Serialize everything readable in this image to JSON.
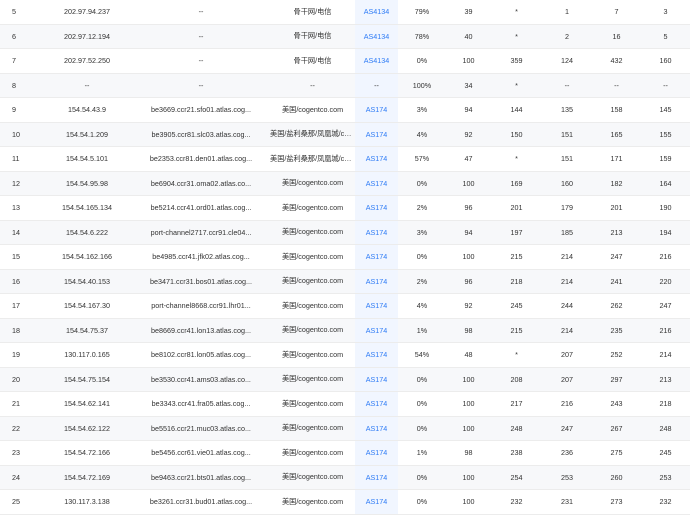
{
  "accent": "#2f7cf6",
  "rows": [
    {
      "hop": "5",
      "ip": "202.97.94.237",
      "host": "--",
      "loc": "骨干网/电信",
      "as": "AS4134",
      "loss": "79%",
      "sent": "39",
      "last": "*",
      "best": "1",
      "avg": "7",
      "worst": "3"
    },
    {
      "hop": "6",
      "ip": "202.97.12.194",
      "host": "--",
      "loc": "骨干网/电信",
      "as": "AS4134",
      "loss": "78%",
      "sent": "40",
      "last": "*",
      "best": "2",
      "avg": "16",
      "worst": "5"
    },
    {
      "hop": "7",
      "ip": "202.97.52.250",
      "host": "--",
      "loc": "骨干网/电信",
      "as": "AS4134",
      "loss": "0%",
      "sent": "100",
      "last": "359",
      "best": "124",
      "avg": "432",
      "worst": "160"
    },
    {
      "hop": "8",
      "ip": "--",
      "host": "--",
      "loc": "--",
      "as": "--",
      "loss": "100%",
      "sent": "34",
      "last": "*",
      "best": "--",
      "avg": "--",
      "worst": "--"
    },
    {
      "hop": "9",
      "ip": "154.54.43.9",
      "host": "be3669.ccr21.sfo01.atlas.cog...",
      "loc": "美国/cogentco.com",
      "as": "AS174",
      "loss": "3%",
      "sent": "94",
      "last": "144",
      "best": "135",
      "avg": "158",
      "worst": "145"
    },
    {
      "hop": "10",
      "ip": "154.54.1.209",
      "host": "be3905.ccr81.slc03.atlas.cog...",
      "loc": "美国/盐利桑那/凤凰城/cogent...",
      "as": "AS174",
      "loss": "4%",
      "sent": "92",
      "last": "150",
      "best": "151",
      "avg": "165",
      "worst": "155"
    },
    {
      "hop": "11",
      "ip": "154.54.5.101",
      "host": "be2353.ccr81.den01.atlas.cog...",
      "loc": "美国/盐利桑那/凤凰城/cogent...",
      "as": "AS174",
      "loss": "57%",
      "sent": "47",
      "last": "*",
      "best": "151",
      "avg": "171",
      "worst": "159"
    },
    {
      "hop": "12",
      "ip": "154.54.95.98",
      "host": "be6904.ccr31.oma02.atlas.co...",
      "loc": "美国/cogentco.com",
      "as": "AS174",
      "loss": "0%",
      "sent": "100",
      "last": "169",
      "best": "160",
      "avg": "182",
      "worst": "164"
    },
    {
      "hop": "13",
      "ip": "154.54.165.134",
      "host": "be5214.ccr41.ord01.atlas.cog...",
      "loc": "美国/cogentco.com",
      "as": "AS174",
      "loss": "2%",
      "sent": "96",
      "last": "201",
      "best": "179",
      "avg": "201",
      "worst": "190"
    },
    {
      "hop": "14",
      "ip": "154.54.6.222",
      "host": "port-channel2717.ccr91.cle04...",
      "loc": "美国/cogentco.com",
      "as": "AS174",
      "loss": "3%",
      "sent": "94",
      "last": "197",
      "best": "185",
      "avg": "213",
      "worst": "194"
    },
    {
      "hop": "15",
      "ip": "154.54.162.166",
      "host": "be4985.ccr41.jfk02.atlas.cog...",
      "loc": "美国/cogentco.com",
      "as": "AS174",
      "loss": "0%",
      "sent": "100",
      "last": "215",
      "best": "214",
      "avg": "247",
      "worst": "216"
    },
    {
      "hop": "16",
      "ip": "154.54.40.153",
      "host": "be3471.ccr31.bos01.atlas.cog...",
      "loc": "美国/cogentco.com",
      "as": "AS174",
      "loss": "2%",
      "sent": "96",
      "last": "218",
      "best": "214",
      "avg": "241",
      "worst": "220"
    },
    {
      "hop": "17",
      "ip": "154.54.167.30",
      "host": "port-channel8668.ccr91.lhr01...",
      "loc": "美国/cogentco.com",
      "as": "AS174",
      "loss": "4%",
      "sent": "92",
      "last": "245",
      "best": "244",
      "avg": "262",
      "worst": "247"
    },
    {
      "hop": "18",
      "ip": "154.54.75.37",
      "host": "be8669.ccr41.lon13.atlas.cog...",
      "loc": "美国/cogentco.com",
      "as": "AS174",
      "loss": "1%",
      "sent": "98",
      "last": "215",
      "best": "214",
      "avg": "235",
      "worst": "216"
    },
    {
      "hop": "19",
      "ip": "130.117.0.165",
      "host": "be8102.ccr81.lon05.atlas.cog...",
      "loc": "美国/cogentco.com",
      "as": "AS174",
      "loss": "54%",
      "sent": "48",
      "last": "*",
      "best": "207",
      "avg": "252",
      "worst": "214"
    },
    {
      "hop": "20",
      "ip": "154.54.75.154",
      "host": "be3530.ccr41.ams03.atlas.co...",
      "loc": "美国/cogentco.com",
      "as": "AS174",
      "loss": "0%",
      "sent": "100",
      "last": "208",
      "best": "207",
      "avg": "297",
      "worst": "213"
    },
    {
      "hop": "21",
      "ip": "154.54.62.141",
      "host": "be3343.ccr41.fra05.atlas.cog...",
      "loc": "美国/cogentco.com",
      "as": "AS174",
      "loss": "0%",
      "sent": "100",
      "last": "217",
      "best": "216",
      "avg": "243",
      "worst": "218"
    },
    {
      "hop": "22",
      "ip": "154.54.62.122",
      "host": "be5516.ccr21.muc03.atlas.co...",
      "loc": "美国/cogentco.com",
      "as": "AS174",
      "loss": "0%",
      "sent": "100",
      "last": "248",
      "best": "247",
      "avg": "267",
      "worst": "248"
    },
    {
      "hop": "23",
      "ip": "154.54.72.166",
      "host": "be5456.ccr61.vie01.atlas.cog...",
      "loc": "美国/cogentco.com",
      "as": "AS174",
      "loss": "1%",
      "sent": "98",
      "last": "238",
      "best": "236",
      "avg": "275",
      "worst": "245"
    },
    {
      "hop": "24",
      "ip": "154.54.72.169",
      "host": "be9463.ccr21.bts01.atlas.cog...",
      "loc": "美国/cogentco.com",
      "as": "AS174",
      "loss": "0%",
      "sent": "100",
      "last": "254",
      "best": "253",
      "avg": "260",
      "worst": "253"
    },
    {
      "hop": "25",
      "ip": "130.117.3.138",
      "host": "be3261.ccr31.bud01.atlas.cog...",
      "loc": "美国/cogentco.com",
      "as": "AS174",
      "loss": "0%",
      "sent": "100",
      "last": "232",
      "best": "231",
      "avg": "273",
      "worst": "232"
    }
  ]
}
